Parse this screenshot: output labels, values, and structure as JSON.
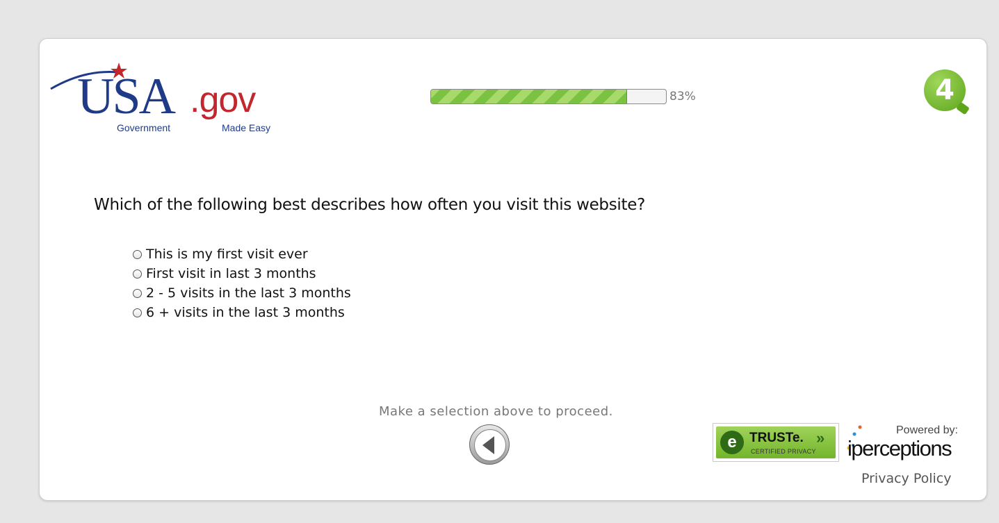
{
  "brand": {
    "logo_main": "USA",
    "logo_domain": ".gov",
    "logo_tagline_left": "Government",
    "logo_tagline_right": "Made Easy",
    "colors": {
      "blue": "#1f3b88",
      "red": "#c1272d"
    }
  },
  "progress": {
    "percent": 83,
    "label": "83%"
  },
  "badge": {
    "text": "4",
    "icon": "4q-logo-icon"
  },
  "question": {
    "text": "Which of the following best describes how often you visit this website?",
    "options": [
      "This is my first visit ever",
      "First visit in last 3 months",
      "2 - 5 visits in the last 3 months",
      "6 + visits in the last 3 months"
    ]
  },
  "footer": {
    "instruction": "Make a selection above to proceed.",
    "back_icon": "back-arrow-icon",
    "truste_name": "TRUSTe.",
    "truste_arrows": "»",
    "truste_sub": "CERTIFIED PRIVACY",
    "powered_by": "Powered by:",
    "vendor": "iperceptions",
    "privacy_link": "Privacy Policy"
  }
}
